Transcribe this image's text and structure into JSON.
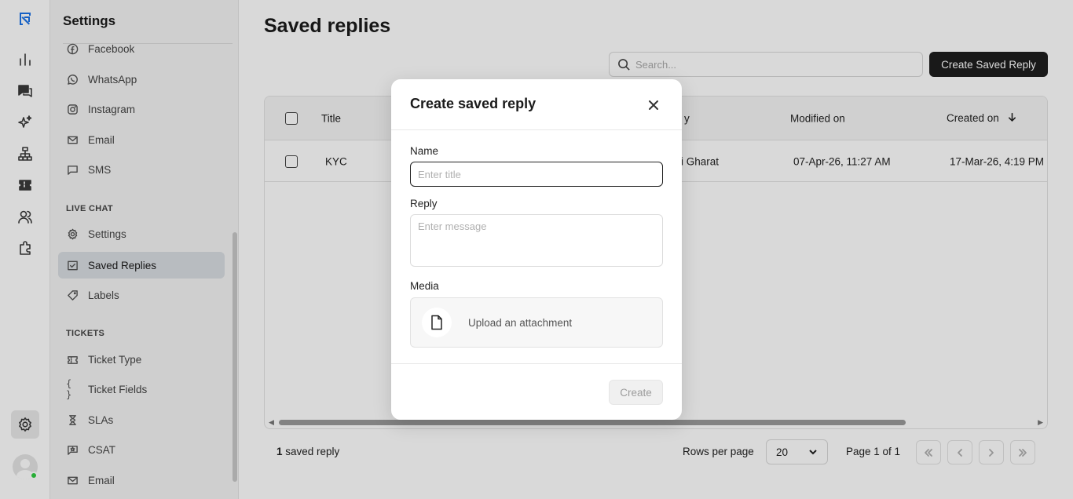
{
  "sidebar": {
    "title": "Settings",
    "channels": [
      "Facebook",
      "WhatsApp",
      "Instagram",
      "Email",
      "SMS"
    ],
    "live_chat_heading": "LIVE CHAT",
    "live_chat": [
      "Settings",
      "Saved Replies",
      "Labels"
    ],
    "tickets_heading": "TICKETS",
    "tickets": [
      "Ticket Type",
      "Ticket Fields",
      "SLAs",
      "CSAT",
      "Email"
    ]
  },
  "main": {
    "title": "Saved replies",
    "search_placeholder": "Search...",
    "create_button": "Create Saved Reply",
    "columns": [
      "Title",
      "y",
      "Modified on",
      "Created on"
    ],
    "rows": [
      {
        "title": "KYC",
        "by": "i Gharat",
        "modified": "07-Apr-26, 11:27 AM",
        "created": "17-Mar-26, 4:19 PM"
      }
    ],
    "footer": {
      "count": "1",
      "count_suffix": " saved reply",
      "rows_per_page_label": "Rows per page",
      "rows_per_page_value": "20",
      "page_label": "Page 1 of 1"
    }
  },
  "modal": {
    "title": "Create saved reply",
    "name_label": "Name",
    "name_placeholder": "Enter title",
    "reply_label": "Reply",
    "reply_placeholder": "Enter message",
    "media_label": "Media",
    "upload_text": "Upload an attachment",
    "create_button": "Create"
  },
  "colors": {
    "primary_button": "#1e1e1e",
    "active_nav": "#d9dde2",
    "online": "#2ecc40",
    "brand": "#1a73e8"
  },
  "icons": {
    "rail": [
      "logo-icon",
      "analytics-icon",
      "chat-icon",
      "sparkle-icon",
      "workflow-icon",
      "ticket-icon",
      "contacts-icon",
      "integrations-icon",
      "settings-gear-icon"
    ]
  }
}
